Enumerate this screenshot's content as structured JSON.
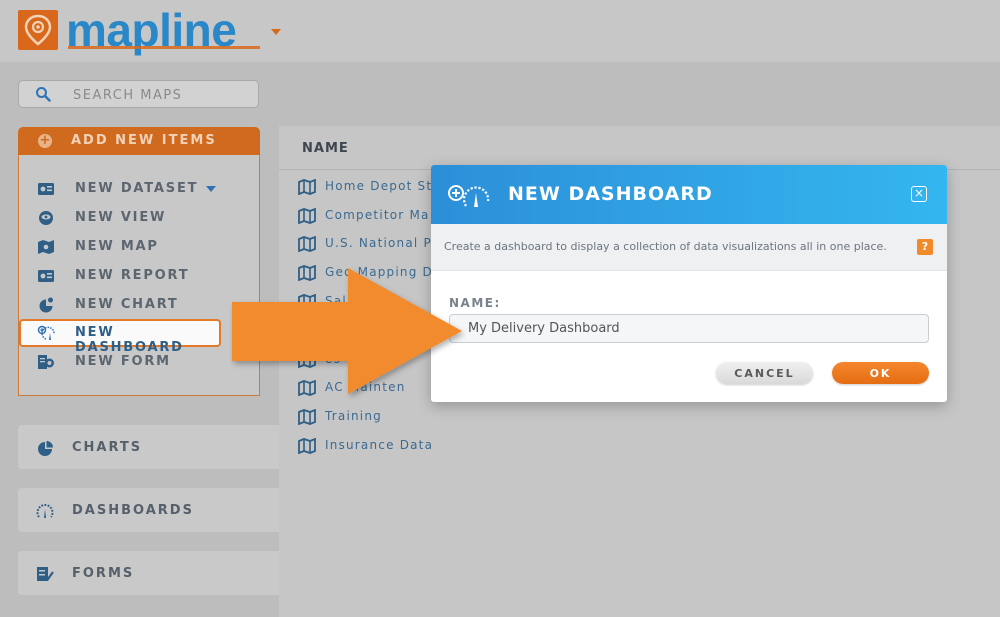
{
  "app": {
    "logo_text": "mapline"
  },
  "sidebar": {
    "search_placeholder": "SEARCH MAPS",
    "add_new_label": "ADD NEW ITEMS",
    "menu_items": [
      {
        "label": "NEW DATASET",
        "icon": "dataset-icon"
      },
      {
        "label": "NEW VIEW",
        "icon": "view-icon"
      },
      {
        "label": "NEW MAP",
        "icon": "map-icon"
      },
      {
        "label": "NEW REPORT",
        "icon": "report-icon"
      },
      {
        "label": "NEW CHART",
        "icon": "chart-icon"
      },
      {
        "label": "NEW DASHBOARD",
        "icon": "dashboard-icon"
      },
      {
        "label": "NEW FORM",
        "icon": "form-icon"
      }
    ],
    "sections": [
      {
        "label": "CHARTS",
        "icon": "pie-chart-icon"
      },
      {
        "label": "DASHBOARDS",
        "icon": "gauge-icon"
      },
      {
        "label": "FORMS",
        "icon": "checklist-icon"
      }
    ]
  },
  "list": {
    "header": "NAME",
    "rows": [
      "Home Depot St",
      "Competitor Ma",
      "U.S. National P",
      "Geo Mapping D",
      "Sal",
      "",
      "es",
      "AC    Mainten",
      "Training",
      "Insurance Data"
    ]
  },
  "modal": {
    "title": "NEW DASHBOARD",
    "description": "Create a dashboard to display a collection of data visualizations all in one place.",
    "help": "?",
    "close": "×",
    "name_label": "NAME:",
    "name_value": "My Delivery Dashboard",
    "cancel_label": "CANCEL",
    "ok_label": "OK"
  },
  "colors": {
    "brand_orange": "#d9681d",
    "brand_blue": "#2a87c8",
    "modal_header_start": "#2c8fd8",
    "modal_header_end": "#34b6f0",
    "ok_button": "#f07a20",
    "callout_arrow": "#f28a2e"
  }
}
